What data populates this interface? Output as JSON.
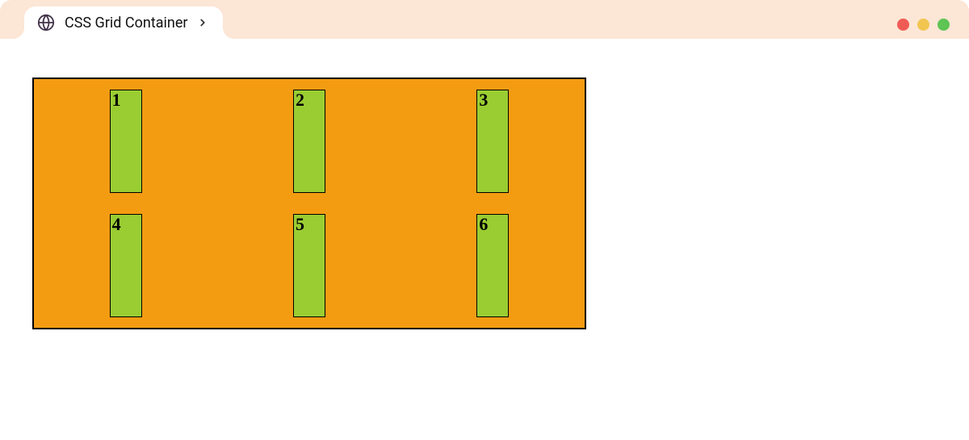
{
  "browser": {
    "tab_title": "CSS Grid Container"
  },
  "grid": {
    "container_bg": "#f39c12",
    "item_bg": "#9acd32",
    "items": [
      "1",
      "2",
      "3",
      "4",
      "5",
      "6"
    ]
  },
  "window_controls": {
    "red": "#ee5c54",
    "yellow": "#f1c550",
    "green": "#5ec454"
  }
}
